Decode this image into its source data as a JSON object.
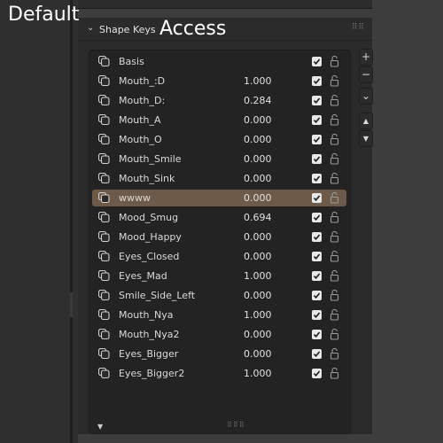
{
  "overlay": {
    "left_label": "Default",
    "right_label": "Access"
  },
  "panel": {
    "title": "Shape Keys"
  },
  "shape_keys": [
    {
      "name": "Basis",
      "value": "",
      "enabled": true,
      "selected": false
    },
    {
      "name": "Mouth_:D",
      "value": "1.000",
      "enabled": true,
      "selected": false
    },
    {
      "name": "Mouth_D:",
      "value": "0.284",
      "enabled": true,
      "selected": false
    },
    {
      "name": "Mouth_A",
      "value": "0.000",
      "enabled": true,
      "selected": false
    },
    {
      "name": "Mouth_O",
      "value": "0.000",
      "enabled": true,
      "selected": false
    },
    {
      "name": "Mouth_Smile",
      "value": "0.000",
      "enabled": true,
      "selected": false
    },
    {
      "name": "Mouth_Sink",
      "value": "0.000",
      "enabled": true,
      "selected": false
    },
    {
      "name": "wwww",
      "value": "0.000",
      "enabled": true,
      "selected": true
    },
    {
      "name": "Mood_Smug",
      "value": "0.694",
      "enabled": true,
      "selected": false
    },
    {
      "name": "Mood_Happy",
      "value": "0.000",
      "enabled": true,
      "selected": false
    },
    {
      "name": "Eyes_Closed",
      "value": "0.000",
      "enabled": true,
      "selected": false
    },
    {
      "name": "Eyes_Mad",
      "value": "1.000",
      "enabled": true,
      "selected": false
    },
    {
      "name": "Smile_Side_Left",
      "value": "0.000",
      "enabled": true,
      "selected": false
    },
    {
      "name": "Mouth_Nya",
      "value": "1.000",
      "enabled": true,
      "selected": false
    },
    {
      "name": "Mouth_Nya2",
      "value": "0.000",
      "enabled": true,
      "selected": false
    },
    {
      "name": "Eyes_Bigger",
      "value": "0.000",
      "enabled": true,
      "selected": false
    },
    {
      "name": "Eyes_Bigger2",
      "value": "1.000",
      "enabled": true,
      "selected": false
    }
  ],
  "side_buttons": [
    {
      "name": "add-shape-key-button",
      "glyph": "+"
    },
    {
      "name": "remove-shape-key-button",
      "glyph": "−"
    },
    {
      "name": "shape-key-specials-menu-button",
      "glyph": "⌄"
    },
    {
      "name": "move-up-button",
      "glyph": "▲"
    },
    {
      "name": "move-down-button",
      "glyph": "▼"
    }
  ],
  "icons": {
    "panel_toggle": "chevron-down-icon",
    "row_key": "shape-key-icon",
    "row_check": "checkbox-icon",
    "row_lock": "lock-icon",
    "list_filter": "triangle-down-icon",
    "resize_grip": "grip-icon"
  },
  "colors": {
    "background": "#3d3d3d",
    "panel": "#2a2a2a",
    "list": "#232323",
    "selected_row": "#6e5a48",
    "text": "#dadada"
  }
}
